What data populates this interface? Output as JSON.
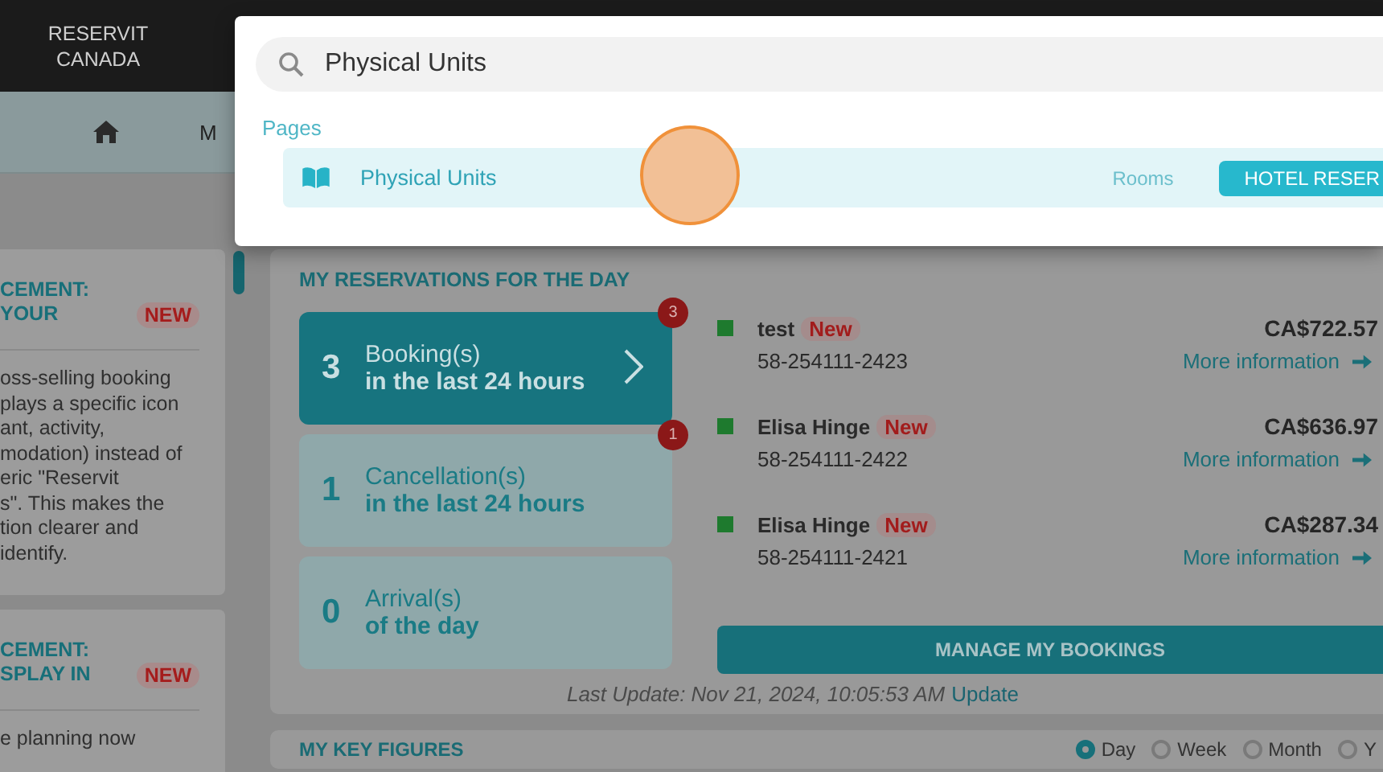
{
  "header": {
    "logo": "RESERVIT CANADA"
  },
  "nav": {
    "items": [
      {
        "kind": "home"
      },
      {
        "kind": "text",
        "label": "M"
      }
    ]
  },
  "announcements": [
    {
      "title": "CEMENT: YOUR",
      "badge": "NEW",
      "lines": [
        "oss-selling booking",
        "plays a specific icon",
        "ant, activity,",
        "modation) instead of",
        "eric \"Reservit",
        "s\". This makes the",
        "tion clearer and",
        "identify."
      ]
    },
    {
      "title": "CEMENT: SPLAY IN",
      "badge": "NEW",
      "lines": [
        "e planning now"
      ]
    }
  ],
  "reservations": {
    "title": "MY RESERVATIONS FOR THE DAY",
    "tiles": [
      {
        "count": "3",
        "label": "Booking(s)",
        "sub": "in the last 24 hours",
        "selected": true,
        "badge": "3"
      },
      {
        "count": "1",
        "label": "Cancellation(s)",
        "sub": "in the last 24 hours",
        "selected": false,
        "badge": "1"
      },
      {
        "count": "0",
        "label": "Arrival(s)",
        "sub": "of the day",
        "selected": false
      }
    ],
    "bookings": [
      {
        "name": "test",
        "tag": "New",
        "number": "58-254111-2423",
        "amount": "CA$722.57",
        "link": "More information",
        "color": "#1e7a2e"
      },
      {
        "name": "Elisa Hinge",
        "tag": "New",
        "number": "58-254111-2422",
        "amount": "CA$636.97",
        "link": "More information",
        "color": "#1e7a2e"
      },
      {
        "name": "Elisa Hinge",
        "tag": "New",
        "number": "58-254111-2421",
        "amount": "CA$287.34",
        "link": "More information",
        "color": "#1e7a2e"
      }
    ],
    "manage_button": "MANAGE MY BOOKINGS",
    "last_update": "Last Update: Nov 21, 2024, 10:05:53 AM",
    "update_link": "Update"
  },
  "key_figures": {
    "title": "MY KEY FIGURES",
    "periods": [
      {
        "label": "Day",
        "selected": true
      },
      {
        "label": "Week",
        "selected": false
      },
      {
        "label": "Month",
        "selected": false
      },
      {
        "label": "Y",
        "selected": false
      }
    ]
  },
  "search_dialog": {
    "value": "Physical Units",
    "section": "Pages",
    "results": [
      {
        "title": "Physical Units",
        "category": "Rooms",
        "tag": "HOTEL RESER"
      }
    ]
  }
}
